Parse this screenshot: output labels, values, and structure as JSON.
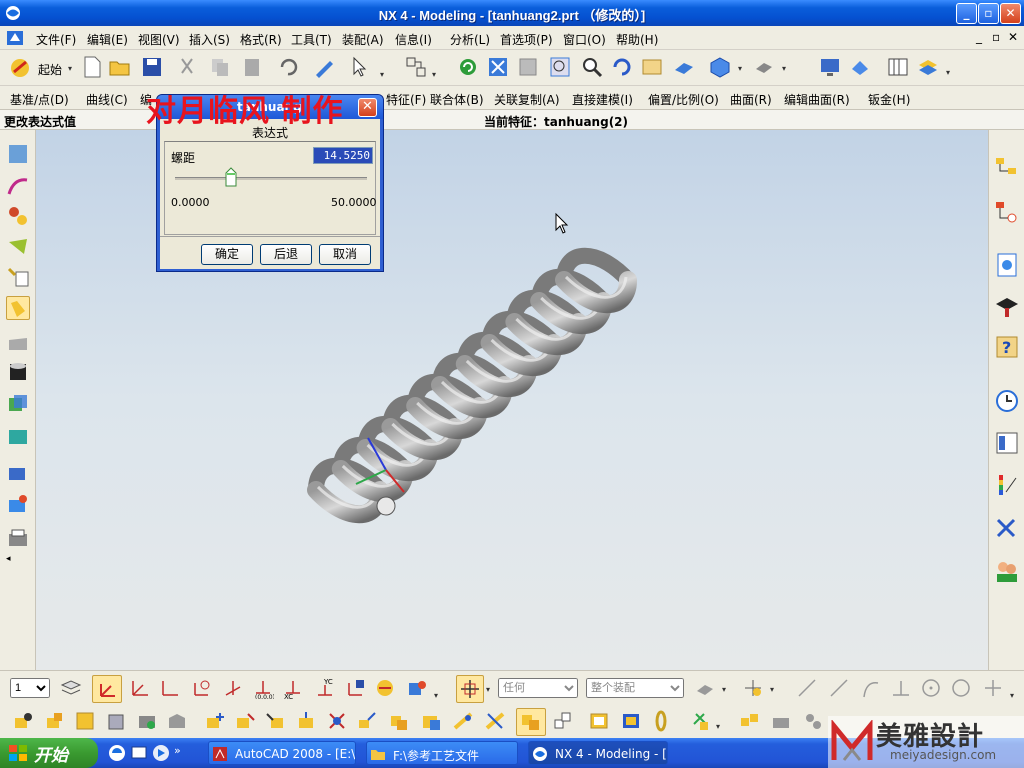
{
  "window": {
    "title": "NX 4 - Modeling - [tanhuang2.prt （修改的）]"
  },
  "menu": [
    "文件(F)",
    "编辑(E)",
    "视图(V)",
    "插入(S)",
    "格式(R)",
    "工具(T)",
    "装配(A)",
    "信息(I)",
    "分析(L)",
    "首选项(P)",
    "窗口(O)",
    "帮助(H)"
  ],
  "toolbar1": {
    "start_label": "起始"
  },
  "toolbar2": {
    "items": [
      "基准/点(D)",
      "曲线(C)",
      "编",
      "特征(F)",
      "联合体(B)",
      "关联复制(A)",
      "直接建模(I)",
      "偏置/比例(O)",
      "曲面(R)",
      "编辑曲面(R)",
      "钣金(H)"
    ]
  },
  "cue": {
    "left": "更改表达式值",
    "right": "当前特征：tanhuang(2)"
  },
  "watermark": "对月临风 制作",
  "dialog": {
    "title": "tanhuang",
    "section": "表达式",
    "param_label": "螺距",
    "param_value": "14.5250",
    "slider_min": "0.0000",
    "slider_max": "50.0000",
    "slider_value": 14.525,
    "slider_range_max": 50,
    "ok": "确定",
    "back": "后退",
    "cancel": "取消"
  },
  "bottom": {
    "layer": "1",
    "filter1": "任何",
    "filter2": "整个装配"
  },
  "taskbar": {
    "start": "开始",
    "tasks": [
      "AutoCAD 2008 - [E:\\...",
      "F:\\参考工艺文件",
      "NX 4 - Modeling - [ta..."
    ]
  },
  "brand": {
    "name": "美雅設計",
    "url": "meiyadesign.com"
  },
  "colors": {
    "accent": "#0A5EDB",
    "dialog_border": "#2F5FD2",
    "watermark": "#E8141E"
  }
}
